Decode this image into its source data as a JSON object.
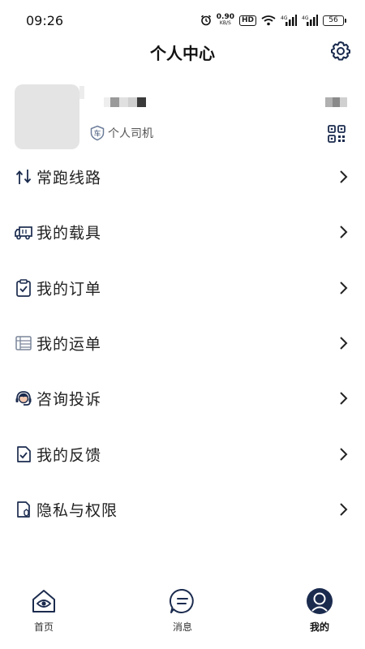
{
  "status_bar": {
    "time": "09:26",
    "net_speed": "0.90",
    "net_unit": "KB/S",
    "hd_badge": "HD",
    "signal_label_1": "4G",
    "signal_label_2": "4G",
    "battery": "56",
    "icons": [
      "alarm-icon",
      "wifi-icon",
      "signal-icon",
      "signal-icon"
    ]
  },
  "header": {
    "title": "个人中心",
    "settings_icon": "gear-icon"
  },
  "profile": {
    "role_badge_char": "车",
    "role_label": "个人司机",
    "qr_icon": "qr-code-icon"
  },
  "menu": {
    "items": [
      {
        "label": "常跑线路",
        "icon": "route-icon"
      },
      {
        "label": "我的载具",
        "icon": "truck-icon"
      },
      {
        "label": "我的订单",
        "icon": "clipboard-check-icon"
      },
      {
        "label": "我的运单",
        "icon": "waybill-icon"
      },
      {
        "label": "咨询投诉",
        "icon": "customer-service-icon"
      },
      {
        "label": "我的反馈",
        "icon": "feedback-icon"
      },
      {
        "label": "隐私与权限",
        "icon": "privacy-icon"
      }
    ]
  },
  "tabbar": {
    "tabs": [
      {
        "label": "首页",
        "icon": "home-icon",
        "active": false
      },
      {
        "label": "消息",
        "icon": "message-icon",
        "active": false
      },
      {
        "label": "我的",
        "icon": "profile-icon",
        "active": true
      }
    ]
  },
  "colors": {
    "navy": "#1b2b4e",
    "text": "#222222",
    "muted": "#555555",
    "avatar_placeholder": "#e4e4e4"
  }
}
